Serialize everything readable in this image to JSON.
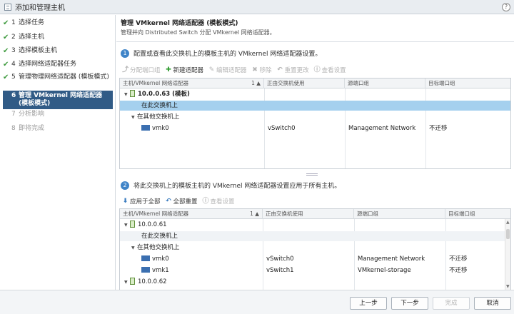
{
  "window": {
    "title": "添加和管理主机",
    "help": "?"
  },
  "steps": [
    {
      "num": "1",
      "label": "选择任务",
      "done": true
    },
    {
      "num": "2",
      "label": "选择主机",
      "done": true
    },
    {
      "num": "3",
      "label": "选择模板主机",
      "done": true
    },
    {
      "num": "4",
      "label": "选择网络适配器任务",
      "done": true
    },
    {
      "num": "5",
      "label": "管理物理网络适配器 (模板模式)",
      "done": true
    },
    {
      "num": "6",
      "label": "管理 VMkernel 网络适配器 (模板模式)",
      "active": true
    },
    {
      "num": "7",
      "label": "分析影响",
      "disabled": true
    },
    {
      "num": "8",
      "label": "即将完成",
      "disabled": true
    }
  ],
  "header": {
    "title": "管理 VMkernel 网络适配器 (模板模式)",
    "subtitle": "管理并向 Distributed Switch 分配 VMkernel 网络适配器。"
  },
  "section1": {
    "badge": "1",
    "text": "配置或查看此交换机上的模板主机的 VMkernel 网络适配器设置。",
    "toolbar": {
      "assign_port": "分配端口组",
      "new_adapter": "新建适配器",
      "edit_adapter": "编辑适配器",
      "remove": "移除",
      "reset": "重置更改",
      "view_settings": "查看设置"
    },
    "columns": [
      "主机/VMkernel 网络适配器",
      "正由交换机使用",
      "源端口组",
      "目标端口组"
    ],
    "sort_indicator": "1 ▲",
    "rows": {
      "host": "10.0.0.63 (模板)",
      "on_switch": "在此交换机上",
      "other_switch": "在其他交换机上",
      "vmk": "vmk0",
      "vmk_switch": "vSwitch0",
      "vmk_source": "Management Network",
      "vmk_target": "不迁移"
    }
  },
  "section2": {
    "badge": "2",
    "text": "将此交换机上的模板主机的 VMkernel 网络适配器设置应用于所有主机。",
    "toolbar": {
      "apply_all": "应用于全部",
      "reset_all": "全部重置",
      "view_settings": "查看设置"
    },
    "columns": [
      "主机/VMkernel 网络适配器",
      "正由交换机使用",
      "源端口组",
      "目标端口组"
    ],
    "sort_indicator": "1 ▲",
    "rows": {
      "host1": "10.0.0.61",
      "on_switch": "在此交换机上",
      "other_switch": "在其他交换机上",
      "vmk0": "vmk0",
      "vmk0_switch": "vSwitch0",
      "vmk0_source": "Management Network",
      "vmk0_target": "不迁移",
      "vmk1": "vmk1",
      "vmk1_switch": "vSwitch1",
      "vmk1_source": "VMkernel-storage",
      "vmk1_target": "不迁移",
      "host2": "10.0.0.62"
    }
  },
  "footer": {
    "back": "上一步",
    "next": "下一步",
    "finish": "完成",
    "cancel": "取消"
  },
  "colors": {
    "accent": "#315b86",
    "selected_row": "#a5d0ee",
    "badge": "#3f84c8",
    "check": "#3f9b3f"
  }
}
